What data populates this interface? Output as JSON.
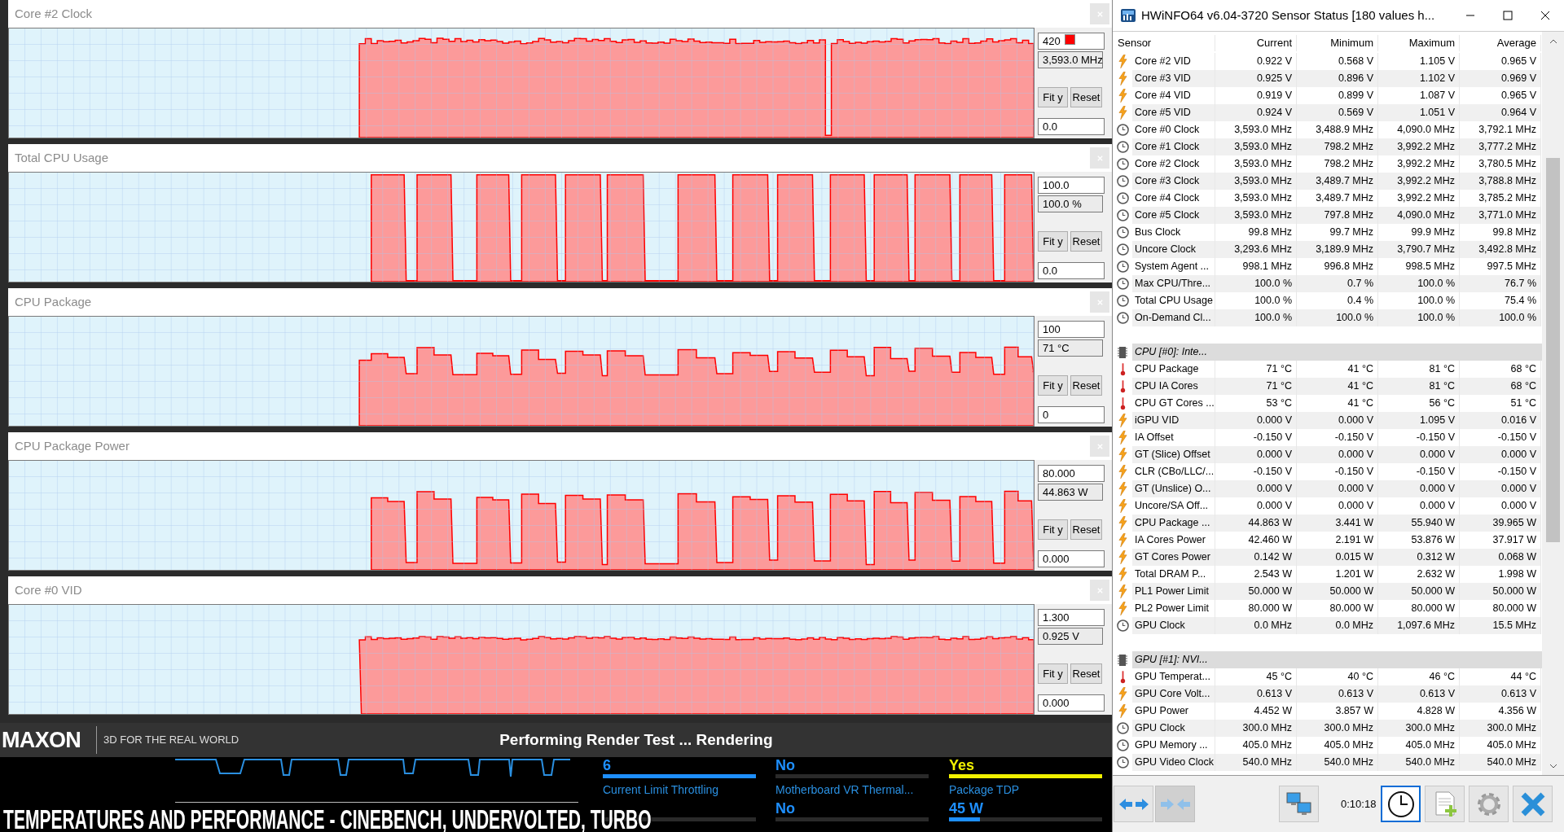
{
  "panels": [
    {
      "title": "Core #2 Clock",
      "kind": "clock",
      "max": "420",
      "swatch": true,
      "current": "3,593.0 MHz",
      "fit": "Fit y",
      "reset": "Reset",
      "min": "0.0"
    },
    {
      "title": "Total CPU Usage",
      "kind": "usage",
      "max": "100.0",
      "swatch": false,
      "current": "100.0 %",
      "fit": "Fit y",
      "reset": "Reset",
      "min": "0.0"
    },
    {
      "title": "CPU Package",
      "kind": "temperature",
      "max": "100",
      "swatch": false,
      "current": "71 °C",
      "fit": "Fit y",
      "reset": "Reset",
      "min": "0"
    },
    {
      "title": "CPU Package Power",
      "kind": "power",
      "max": "80.000",
      "swatch": false,
      "current": "44.863 W",
      "fit": "Fit y",
      "reset": "Reset",
      "min": "0.000"
    },
    {
      "title": "Core #0 VID",
      "kind": "voltage",
      "max": "1.300",
      "swatch": false,
      "current": "0.925 V",
      "fit": "Fit y",
      "reset": "Reset",
      "min": "0.000"
    }
  ],
  "cinebench": {
    "logo": "MAXON",
    "tagline": "3D FOR THE REAL WORLD",
    "status": "Performing Render Test ... Rendering",
    "stats": [
      {
        "value": "6",
        "color": "#1e8fff",
        "level": 1
      },
      {
        "value": "No"
      },
      {
        "value": "Yes",
        "color": "#f2f200",
        "level": 1
      },
      {
        "label": "Current Limit Throttling"
      },
      {
        "label": "Motherboard VR Thermal...",
        "value": "No"
      },
      {
        "label": "Package TDP",
        "value": "45 W",
        "color": "#1e8fff",
        "level": 0.2
      }
    ]
  },
  "caption": "TEMPERATURES AND PERFORMANCE - CINEBENCH, UNDERVOLTED, TURBO",
  "hwinfo": {
    "title": "HWiNFO64 v6.04-3720 Sensor Status [180 values h...",
    "columns": [
      "Sensor",
      "Current",
      "Minimum",
      "Maximum",
      "Average"
    ],
    "sections": [
      {
        "rows": [
          {
            "kind": "volt",
            "name": "Core #2 VID",
            "values": [
              "0.922 V",
              "0.568 V",
              "1.105 V",
              "0.965 V"
            ]
          },
          {
            "kind": "volt",
            "name": "Core #3 VID",
            "values": [
              "0.925 V",
              "0.896 V",
              "1.102 V",
              "0.969 V"
            ]
          },
          {
            "kind": "volt",
            "name": "Core #4 VID",
            "values": [
              "0.919 V",
              "0.899 V",
              "1.087 V",
              "0.965 V"
            ]
          },
          {
            "kind": "volt",
            "name": "Core #5 VID",
            "values": [
              "0.924 V",
              "0.569 V",
              "1.051 V",
              "0.964 V"
            ]
          },
          {
            "kind": "clock",
            "name": "Core #0 Clock",
            "values": [
              "3,593.0 MHz",
              "3,488.9 MHz",
              "4,090.0 MHz",
              "3,792.1 MHz"
            ]
          },
          {
            "kind": "clock",
            "name": "Core #1 Clock",
            "values": [
              "3,593.0 MHz",
              "798.2 MHz",
              "3,992.2 MHz",
              "3,777.2 MHz"
            ]
          },
          {
            "kind": "clock",
            "name": "Core #2 Clock",
            "values": [
              "3,593.0 MHz",
              "798.2 MHz",
              "3,992.2 MHz",
              "3,780.5 MHz"
            ]
          },
          {
            "kind": "clock",
            "name": "Core #3 Clock",
            "values": [
              "3,593.0 MHz",
              "3,489.7 MHz",
              "3,992.2 MHz",
              "3,788.8 MHz"
            ]
          },
          {
            "kind": "clock",
            "name": "Core #4 Clock",
            "values": [
              "3,593.0 MHz",
              "3,489.7 MHz",
              "3,992.2 MHz",
              "3,785.2 MHz"
            ]
          },
          {
            "kind": "clock",
            "name": "Core #5 Clock",
            "values": [
              "3,593.0 MHz",
              "797.8 MHz",
              "4,090.0 MHz",
              "3,771.0 MHz"
            ]
          },
          {
            "kind": "clock",
            "name": "Bus Clock",
            "values": [
              "99.8 MHz",
              "99.7 MHz",
              "99.9 MHz",
              "99.8 MHz"
            ]
          },
          {
            "kind": "clock",
            "name": "Uncore Clock",
            "values": [
              "3,293.6 MHz",
              "3,189.9 MHz",
              "3,790.7 MHz",
              "3,492.8 MHz"
            ]
          },
          {
            "kind": "clock",
            "name": "System Agent ...",
            "values": [
              "998.1 MHz",
              "996.8 MHz",
              "998.5 MHz",
              "997.5 MHz"
            ]
          },
          {
            "kind": "clock",
            "name": "Max CPU/Thre...",
            "values": [
              "100.0 %",
              "0.7 %",
              "100.0 %",
              "76.7 %"
            ]
          },
          {
            "kind": "clock",
            "name": "Total CPU Usage",
            "values": [
              "100.0 %",
              "0.4 %",
              "100.0 %",
              "75.4 %"
            ]
          },
          {
            "kind": "clock",
            "name": "On-Demand Cl...",
            "values": [
              "100.0 %",
              "100.0 %",
              "100.0 %",
              "100.0 %"
            ]
          }
        ]
      },
      {
        "header": "CPU [#0]: Inte...",
        "rows": [
          {
            "kind": "temp",
            "name": "CPU Package",
            "values": [
              "71 °C",
              "41 °C",
              "81 °C",
              "68 °C"
            ]
          },
          {
            "kind": "temp",
            "name": "CPU IA Cores",
            "values": [
              "71 °C",
              "41 °C",
              "81 °C",
              "68 °C"
            ]
          },
          {
            "kind": "temp",
            "name": "CPU GT Cores ...",
            "values": [
              "53 °C",
              "41 °C",
              "56 °C",
              "51 °C"
            ]
          },
          {
            "kind": "volt",
            "name": "iGPU VID",
            "values": [
              "0.000 V",
              "0.000 V",
              "1.095 V",
              "0.016 V"
            ]
          },
          {
            "kind": "volt",
            "name": "IA Offset",
            "values": [
              "-0.150 V",
              "-0.150 V",
              "-0.150 V",
              "-0.150 V"
            ]
          },
          {
            "kind": "volt",
            "name": "GT (Slice) Offset",
            "values": [
              "0.000 V",
              "0.000 V",
              "0.000 V",
              "0.000 V"
            ]
          },
          {
            "kind": "volt",
            "name": "CLR (CBo/LLC/...",
            "values": [
              "-0.150 V",
              "-0.150 V",
              "-0.150 V",
              "-0.150 V"
            ]
          },
          {
            "kind": "volt",
            "name": "GT (Unslice) O...",
            "values": [
              "0.000 V",
              "0.000 V",
              "0.000 V",
              "0.000 V"
            ]
          },
          {
            "kind": "volt",
            "name": "Uncore/SA Off...",
            "values": [
              "0.000 V",
              "0.000 V",
              "0.000 V",
              "0.000 V"
            ]
          },
          {
            "kind": "volt",
            "name": "CPU Package ...",
            "values": [
              "44.863 W",
              "3.441 W",
              "55.940 W",
              "39.965 W"
            ]
          },
          {
            "kind": "volt",
            "name": "IA Cores Power",
            "values": [
              "42.460 W",
              "2.191 W",
              "53.876 W",
              "37.917 W"
            ]
          },
          {
            "kind": "volt",
            "name": "GT Cores Power",
            "values": [
              "0.142 W",
              "0.015 W",
              "0.312 W",
              "0.068 W"
            ]
          },
          {
            "kind": "volt",
            "name": "Total DRAM P...",
            "values": [
              "2.543 W",
              "1.201 W",
              "2.632 W",
              "1.998 W"
            ]
          },
          {
            "kind": "volt",
            "name": "PL1 Power Limit",
            "values": [
              "50.000 W",
              "50.000 W",
              "50.000 W",
              "50.000 W"
            ]
          },
          {
            "kind": "volt",
            "name": "PL2 Power Limit",
            "values": [
              "80.000 W",
              "80.000 W",
              "80.000 W",
              "80.000 W"
            ]
          },
          {
            "kind": "clock",
            "name": "GPU Clock",
            "values": [
              "0.0 MHz",
              "0.0 MHz",
              "1,097.6 MHz",
              "15.5 MHz"
            ]
          }
        ]
      },
      {
        "header": "GPU [#1]: NVI...",
        "rows": [
          {
            "kind": "temp",
            "name": "GPU Temperat...",
            "values": [
              "45 °C",
              "40 °C",
              "46 °C",
              "44 °C"
            ]
          },
          {
            "kind": "volt",
            "name": "GPU Core Volt...",
            "values": [
              "0.613 V",
              "0.613 V",
              "0.613 V",
              "0.613 V"
            ]
          },
          {
            "kind": "volt",
            "name": "GPU Power",
            "values": [
              "4.452 W",
              "3.857 W",
              "4.828 W",
              "4.356 W"
            ]
          },
          {
            "kind": "clock",
            "name": "GPU Clock",
            "values": [
              "300.0 MHz",
              "300.0 MHz",
              "300.0 MHz",
              "300.0 MHz"
            ]
          },
          {
            "kind": "clock",
            "name": "GPU Memory ...",
            "values": [
              "405.0 MHz",
              "405.0 MHz",
              "405.0 MHz",
              "405.0 MHz"
            ]
          },
          {
            "kind": "clock",
            "name": "GPU Video Clock",
            "values": [
              "540.0 MHz",
              "540.0 MHz",
              "540.0 MHz",
              "540.0 MHz"
            ]
          }
        ]
      }
    ],
    "toolbar": {
      "left": [
        {
          "kind": "expand",
          "disabled": false
        },
        {
          "kind": "collapse",
          "disabled": true
        }
      ],
      "network": {
        "kind": "network"
      },
      "elapsed": "0:10:18",
      "right": [
        {
          "kind": "clock",
          "selected": true
        },
        {
          "kind": "report",
          "selected": false
        },
        {
          "kind": "settings",
          "selected": false
        },
        {
          "kind": "close",
          "selected": false
        }
      ]
    }
  }
}
